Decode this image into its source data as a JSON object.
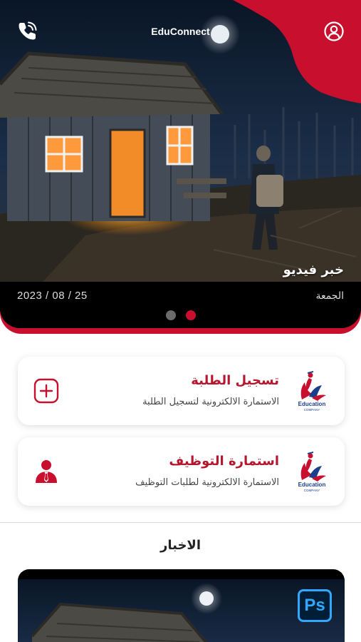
{
  "app": {
    "title": "EduConnect"
  },
  "header": {
    "phone_icon": "phone-icon",
    "profile_icon": "user-circle-icon"
  },
  "hero": {
    "caption": "خبر فيديو",
    "day": "الجمعة",
    "date": "2023 / 08 / 25",
    "slides": 2,
    "active_slide": 2
  },
  "services": [
    {
      "title": "تسجيل الطلبة",
      "subtitle": "الاستمارة الالكترونية لتسجيل الطلبة",
      "logo_text": "Education",
      "logo_subtext": "COMPANY",
      "action_icon": "plus-square-icon"
    },
    {
      "title": "استمارة التوظيف",
      "subtitle": "الاستمارة الالكترونية لطلبات التوظيف",
      "logo_text": "Education",
      "logo_subtext": "COMPANY",
      "action_icon": "employee-icon"
    }
  ],
  "news": {
    "heading": "الاخبار",
    "badge": "Ps"
  },
  "colors": {
    "brand_red": "#c8102e",
    "title_red": "#b5172f",
    "ps_blue": "#31a8ff",
    "ps_bg": "#001e36"
  }
}
